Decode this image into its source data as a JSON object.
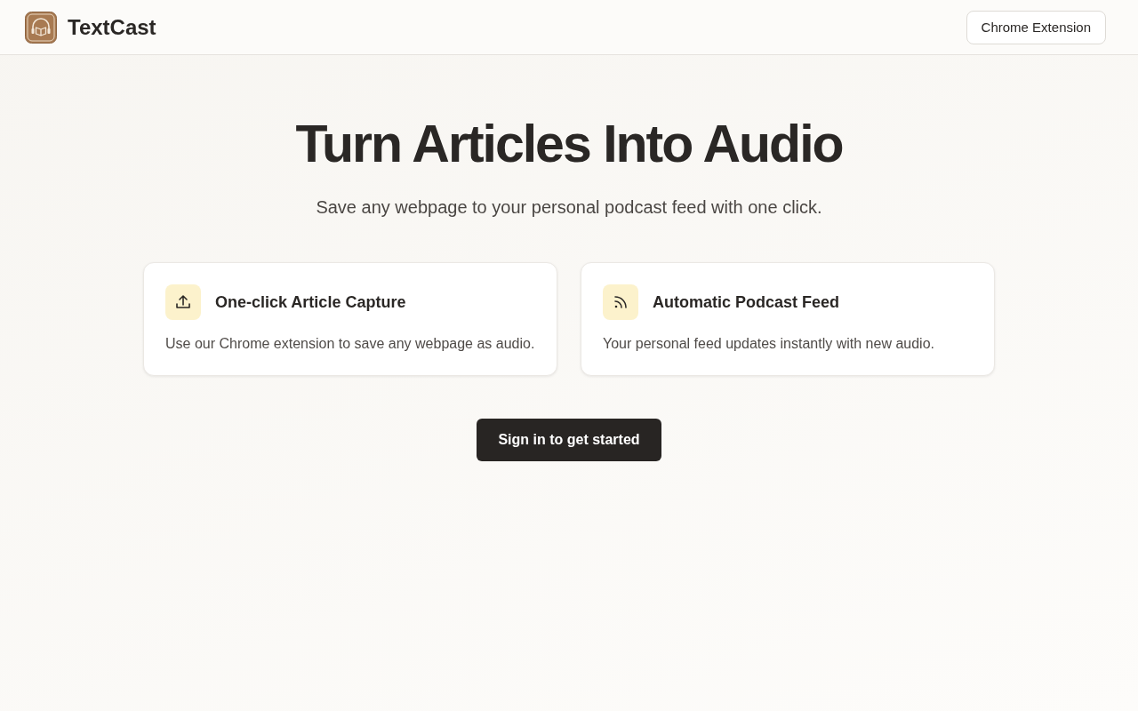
{
  "header": {
    "brand": "TextCast",
    "action": "Chrome Extension"
  },
  "hero": {
    "title": "Turn Articles Into Audio",
    "subtitle": "Save any webpage to your personal podcast feed with one click."
  },
  "features": [
    {
      "kind": "upload",
      "title": "One-click Article Capture",
      "text": "Use our Chrome extension to save any webpage as audio."
    },
    {
      "kind": "feed",
      "title": "Automatic Podcast Feed",
      "text": "Your personal feed updates instantly with new audio."
    }
  ],
  "cta": "Sign in to get started"
}
